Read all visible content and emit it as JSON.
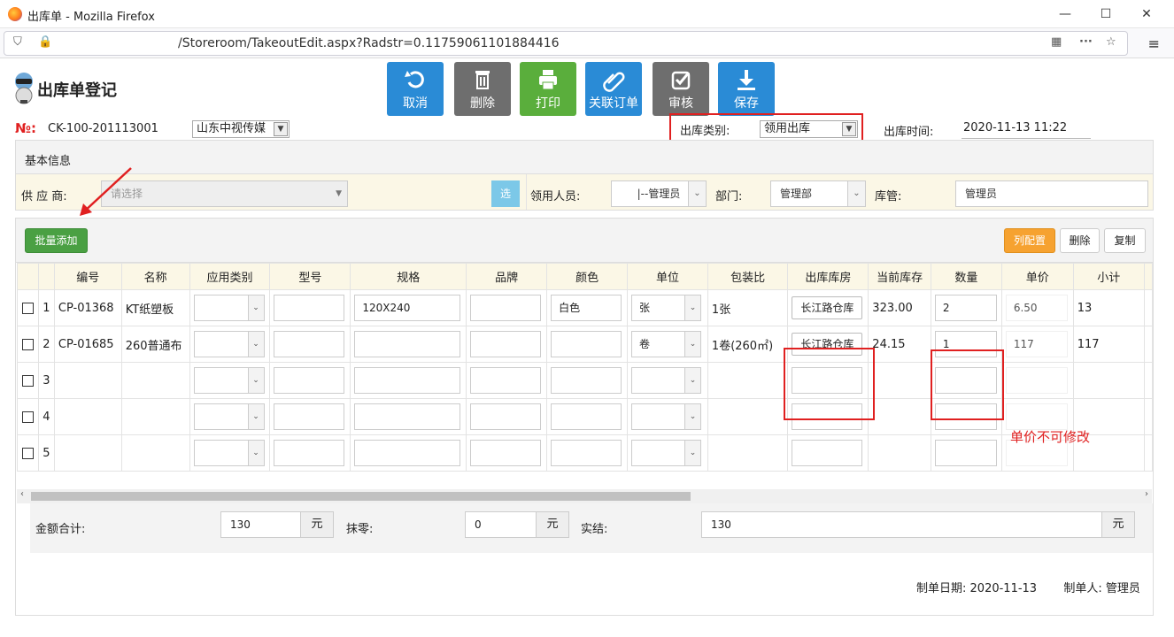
{
  "window": {
    "title": "出库单 - Mozilla Firefox",
    "min": "—",
    "max": "☐",
    "close": "✕"
  },
  "browser": {
    "url": "/Storeroom/TakeoutEdit.aspx?Radstr=0.11759061101884416",
    "menu": "≡"
  },
  "page": {
    "title": "出库单登记"
  },
  "toolbar": [
    {
      "label": "取消",
      "icon": "undo-icon",
      "color": "#2a8bd6"
    },
    {
      "label": "删除",
      "icon": "trash-icon",
      "color": "#6e6e6e"
    },
    {
      "label": "打印",
      "icon": "printer-icon",
      "color": "#5aae3c"
    },
    {
      "label": "关联订单",
      "icon": "paperclip-icon",
      "color": "#2a8bd6"
    },
    {
      "label": "审核",
      "icon": "checkbox-icon",
      "color": "#6e6e6e"
    },
    {
      "label": "保存",
      "icon": "download-icon",
      "color": "#2a8bd6"
    }
  ],
  "header": {
    "no_label": "№:",
    "no_value": "CK-100-201113001",
    "company": "山东中视传媒",
    "type_label": "出库类别:",
    "type_value": "领用出库",
    "time_label": "出库时间:",
    "time_value": "2020-11-13 11:22"
  },
  "basic": {
    "section_title": "基本信息",
    "supplier_label": "供 应 商:",
    "supplier_placeholder": "请选择",
    "pick_button": "选",
    "receiver_label": "领用人员:",
    "receiver_value": "|--管理员",
    "dept_label": "部门:",
    "dept_value": "管理部",
    "keeper_label": "库管:",
    "keeper_value": "管理员"
  },
  "grid": {
    "batch_add": "批量添加",
    "col_config": "列配置",
    "delete": "删除",
    "copy": "复制",
    "columns": [
      "编号",
      "名称",
      "应用类别",
      "型号",
      "规格",
      "品牌",
      "颜色",
      "单位",
      "包装比",
      "出库库房",
      "当前库存",
      "数量",
      "单价",
      "小计"
    ],
    "rows": [
      {
        "idx": "1",
        "code": "CP-01368",
        "name": "KT纸塑板",
        "spec": "120X240",
        "color": "白色",
        "unit": "张",
        "pack": "1张",
        "store": "长江路仓库",
        "stock": "323.00",
        "qty": "2",
        "price": "6.50",
        "subtotal": "13"
      },
      {
        "idx": "2",
        "code": "CP-01685",
        "name": "260普通布",
        "spec": "",
        "color": "",
        "unit": "卷",
        "pack": "1卷(260㎡)",
        "store": "长江路仓库",
        "stock": "24.15",
        "qty": "1",
        "price": "117",
        "subtotal": "117"
      },
      {
        "idx": "3",
        "code": "",
        "name": "",
        "spec": "",
        "color": "",
        "unit": "",
        "pack": "",
        "store": "",
        "stock": "",
        "qty": "",
        "price": "",
        "subtotal": ""
      },
      {
        "idx": "4",
        "code": "",
        "name": "",
        "spec": "",
        "color": "",
        "unit": "",
        "pack": "",
        "store": "",
        "stock": "",
        "qty": "",
        "price": "",
        "subtotal": ""
      },
      {
        "idx": "5",
        "code": "",
        "name": "",
        "spec": "",
        "color": "",
        "unit": "",
        "pack": "",
        "store": "",
        "stock": "",
        "qty": "",
        "price": "",
        "subtotal": ""
      }
    ],
    "note": "单价不可修改"
  },
  "totals": {
    "amount_label": "金额合计:",
    "amount_value": "130",
    "unit": "元",
    "round_label": "抹零:",
    "round_value": "0",
    "actual_label": "实结:",
    "actual_value": "130"
  },
  "footer": {
    "date_label": "制单日期:",
    "date_value": "2020-11-13",
    "maker_label": "制单人:",
    "maker_value": "管理员"
  }
}
